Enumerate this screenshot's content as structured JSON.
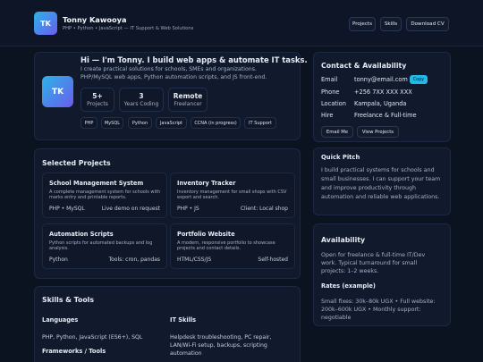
{
  "header": {
    "logo_text": "TK",
    "name": "Tonny Kawooya",
    "tagline": "PHP • Python • JavaScript — IT Support & Web Solutions",
    "nav": [
      "Projects",
      "Skills",
      "Download CV"
    ]
  },
  "hero": {
    "avatar_text": "TK",
    "title": "Hi — I'm Tonny. I build web apps & automate IT tasks.",
    "subtitle_line1": "I create practical solutions for schools, SMEs and organizations.",
    "subtitle_line2": "PHP/MySQL web apps, Python automation scripts, and JS front-end.",
    "stats": [
      {
        "value": "5+",
        "label": "Projects"
      },
      {
        "value": "3",
        "label": "Years Coding"
      },
      {
        "value": "Remote",
        "label": "Freelancer"
      }
    ],
    "tags": [
      "PHP",
      "MySQL",
      "Python",
      "JavaScript",
      "CCNA (in progress)",
      "IT Support"
    ]
  },
  "projects": {
    "heading": "Selected Projects",
    "items": [
      {
        "title": "School Management System",
        "desc": "A complete management system for schools with marks entry and printable reports.",
        "left": "PHP • MySQL",
        "right": "Live demo on request"
      },
      {
        "title": "Inventory Tracker",
        "desc": "Inventory management for small shops with CSV export and search.",
        "left": "PHP • JS",
        "right": "Client: Local shop"
      },
      {
        "title": "Automation Scripts",
        "desc": "Python scripts for automated backups and log analysis.",
        "left": "Python",
        "right": "Tools: cron, pandas"
      },
      {
        "title": "Portfolio Website",
        "desc": "A modern, responsive portfolio to showcase projects and contact details.",
        "left": "HTML/CSS/JS",
        "right": "Self-hosted"
      }
    ]
  },
  "skills": {
    "heading": "Skills & Tools",
    "languages_heading": "Languages",
    "languages": "PHP, Python, JavaScript (ES6+), SQL",
    "frameworks_heading": "Frameworks / Tools",
    "it_heading": "IT Skills",
    "it_line1": "Helpdesk troubleshooting, PC repair,",
    "it_line2": "LAN/Wi-Fi setup, backups, scripting",
    "it_line3": "automation"
  },
  "contact": {
    "heading": "Contact & Availability",
    "rows": [
      {
        "label": "Email",
        "value": "tonny@email.com"
      },
      {
        "label": "Phone",
        "value": "+256 7XX XXX XXX"
      },
      {
        "label": "Location",
        "value": "Kampala, Uganda"
      },
      {
        "label": "Hire",
        "value": "Freelance & Full-time"
      }
    ],
    "copy_label": "Copy",
    "email_me": "Email Me",
    "view_projects": "View Projects"
  },
  "pitch": {
    "heading": "Quick Pitch",
    "lines": [
      "I build practical systems for schools and",
      "small businesses. I can support your team",
      "and improve productivity through",
      "automation and reliable web applications."
    ]
  },
  "availability": {
    "heading": "Availability",
    "lines": [
      "Open for freelance & full-time IT/Dev",
      "work. Typical turnaround for small",
      "projects: 1–2 weeks."
    ],
    "rates_heading": "Rates (example)",
    "rates_lines": [
      "Small fixes: 30k–80k UGX • Full website:",
      "200k–600k UGX • Monthly support:",
      "negotiable"
    ]
  },
  "colors": {
    "background": "#0b1220",
    "card": "#111a2c",
    "accent_cyan": "#2bb3e6",
    "accent_purple": "#6b5cf0",
    "copy_button": "#22b8e8"
  }
}
